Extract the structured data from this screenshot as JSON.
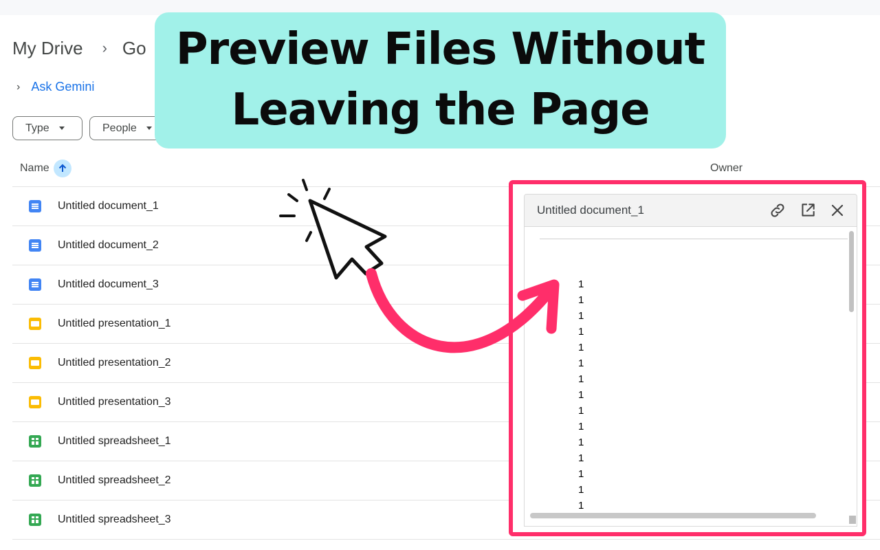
{
  "breadcrumb": {
    "root": "My Drive",
    "separator": "›",
    "current": "Go"
  },
  "gemini": {
    "chevron": "›",
    "label": "Ask Gemini"
  },
  "filters": [
    {
      "label": "Type"
    },
    {
      "label": "People"
    }
  ],
  "columns": {
    "name": "Name",
    "owner": "Owner"
  },
  "files": [
    {
      "name": "Untitled document_1",
      "type": "doc"
    },
    {
      "name": "Untitled document_2",
      "type": "doc"
    },
    {
      "name": "Untitled document_3",
      "type": "doc"
    },
    {
      "name": "Untitled presentation_1",
      "type": "slide"
    },
    {
      "name": "Untitled presentation_2",
      "type": "slide"
    },
    {
      "name": "Untitled presentation_3",
      "type": "slide"
    },
    {
      "name": "Untitled spreadsheet_1",
      "type": "sheet"
    },
    {
      "name": "Untitled spreadsheet_2",
      "type": "sheet"
    },
    {
      "name": "Untitled spreadsheet_3",
      "type": "sheet"
    }
  ],
  "preview": {
    "title": "Untitled document_1",
    "icons": [
      "link-icon",
      "open-in-new-icon",
      "close-icon"
    ],
    "lines": [
      "1",
      "1",
      "1",
      "1",
      "1",
      "1",
      "1",
      "1",
      "1",
      "1",
      "1",
      "1",
      "1",
      "1",
      "1"
    ]
  },
  "banner": {
    "line1": "Preview Files Without",
    "line2": "Leaving the Page"
  },
  "colors": {
    "accent": "#1a73e8",
    "banner_bg": "#a1f1e9",
    "highlight": "#ff2e6a",
    "sort_chip": "#c2e7ff"
  }
}
